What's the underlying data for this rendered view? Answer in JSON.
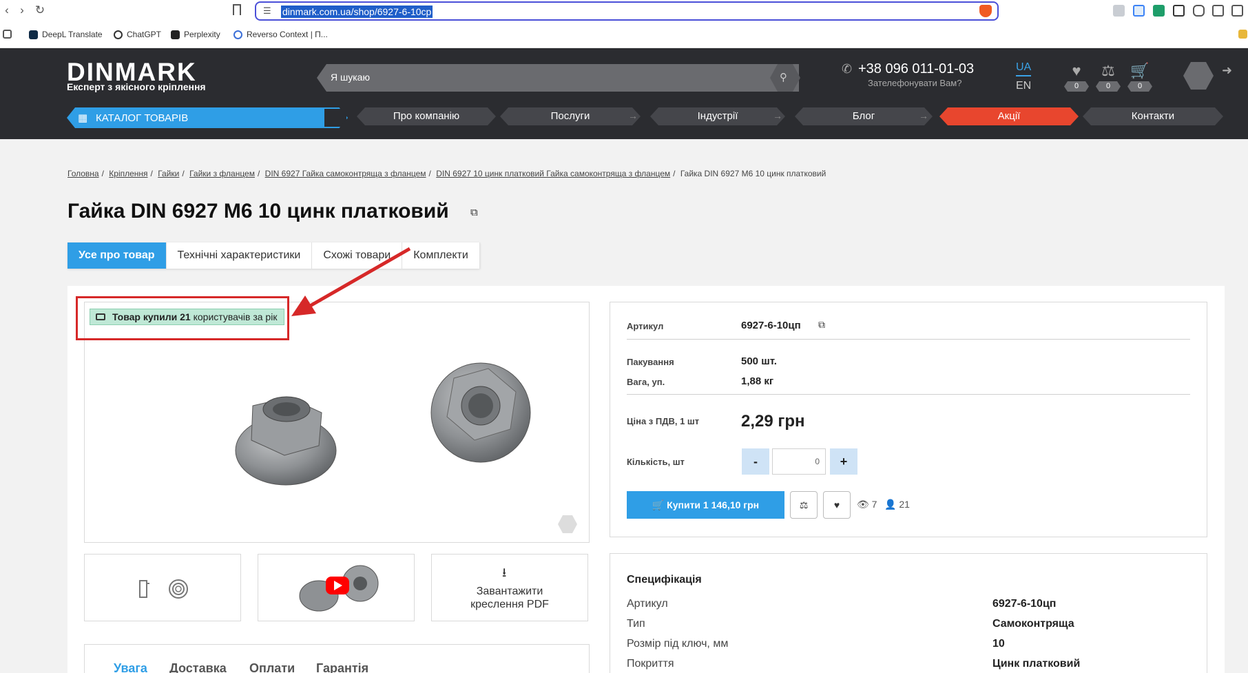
{
  "browser": {
    "url": "dinmark.com.ua/shop/6927-6-10cp",
    "bookmarks": [
      "DeepL Translate",
      "ChatGPT",
      "Perplexity",
      "Reverso Context | П..."
    ]
  },
  "header": {
    "logo": "DINMARK",
    "tagline": "Експерт з якісного кріплення",
    "search_placeholder": "Я шукаю",
    "phone": "+38 096 011-01-03",
    "phone_sub": "Зателефонувати Вам?",
    "lang_active": "UA",
    "lang_other": "EN",
    "wishlist_count": "0",
    "compare_count": "0",
    "cart_count": "0",
    "catalog_label": "КАТАЛОГ ТОВАРІВ",
    "menu": [
      "Про компанію",
      "Послуги",
      "Індустрії",
      "Блог",
      "Акції",
      "Контакти"
    ]
  },
  "breadcrumb": {
    "links": [
      "Головна",
      "Кріплення",
      "Гайки",
      "Гайки з фланцем",
      "DIN 6927 Гайка самоконтряща з фланцем",
      "DIN 6927 10 цинк платковий Гайка самоконтряща з фланцем"
    ],
    "current": "Гайка DIN 6927 M6 10 цинк платковий"
  },
  "product": {
    "title": "Гайка DIN 6927 M6 10 цинк платковий",
    "tabs": [
      "Усе про товар",
      "Технічні характеристики",
      "Схожі товари",
      "Комплекти"
    ],
    "badge_bold": "Товар купили 21",
    "badge_rest": "користувачів за рік",
    "pdf_label_1": "Завантажити",
    "pdf_label_2": "креслення PDF",
    "info_tabs": [
      "Увага",
      "Доставка",
      "Оплати",
      "Гарантія"
    ]
  },
  "buy": {
    "article_label": "Артикул",
    "article_value": "6927-6-10цп",
    "pack_label": "Пакування",
    "pack_value": "500 шт.",
    "weight_label": "Вага, уп.",
    "weight_value": "1,88 кг",
    "price_label": "Ціна з ПДВ, 1 шт",
    "price_value": "2,29 грн",
    "qty_label": "Кількість, шт",
    "qty_value": "0",
    "minus": "-",
    "plus": "+",
    "buy_button": "Купити 1 146,10 грн",
    "views": "7",
    "buyers": "21"
  },
  "spec": {
    "title": "Специфікація",
    "rows": [
      {
        "label": "Артикул",
        "value": "6927-6-10цп"
      },
      {
        "label": "Тип",
        "value": "Самоконтряща"
      },
      {
        "label": "Розмір під ключ, мм",
        "value": "10"
      },
      {
        "label": "Покриття",
        "value": "Цинк платковий"
      }
    ]
  },
  "colors": {
    "brand_blue": "#2f9ee6",
    "header_dark": "#2b2c30",
    "promo_red": "#e8462e",
    "annotation_red": "#d62828",
    "badge_green": "#bfe8d6"
  }
}
